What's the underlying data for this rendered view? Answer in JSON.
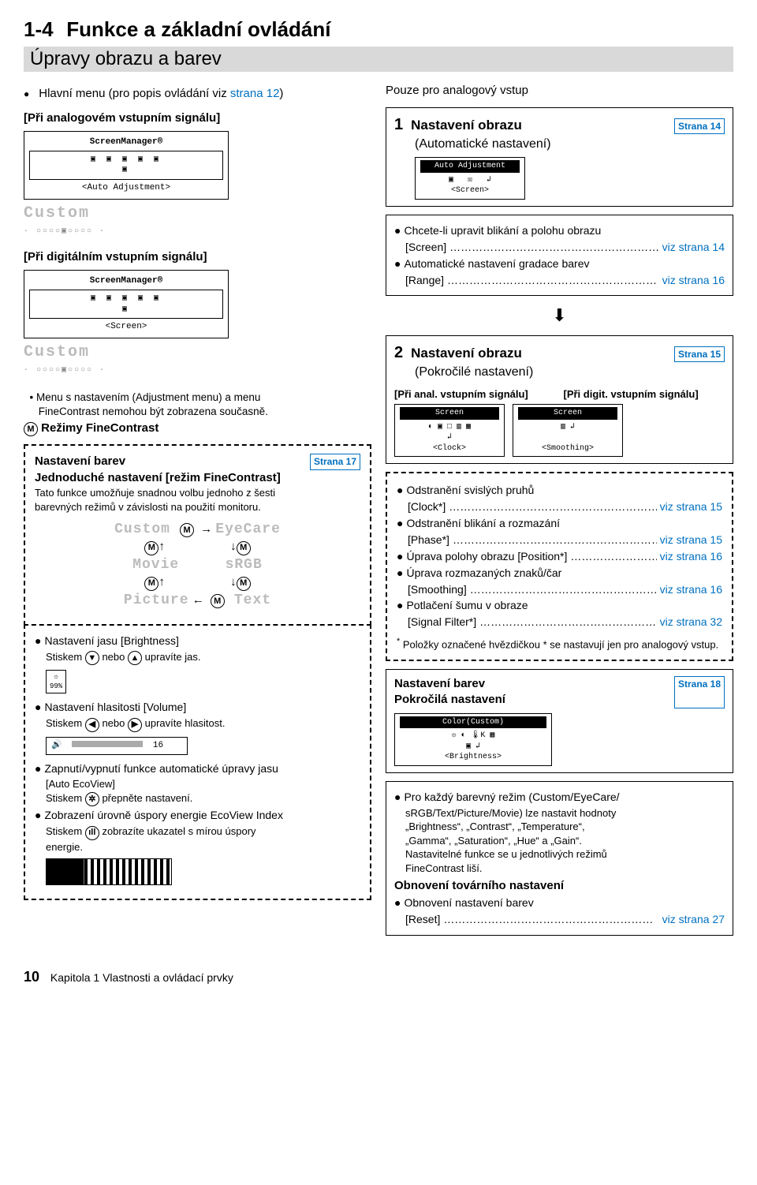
{
  "header": {
    "section": "1-4",
    "title": "Funkce a základní ovládání",
    "subsection": "Úpravy obrazu a barev"
  },
  "left": {
    "mainMenuLine_pre": "Hlavní menu (pro popis ovládání viz ",
    "mainMenuLine_link": "strana 12",
    "mainMenuLine_post": ")",
    "analogSignal": "[Při analogovém vstupním signálu]",
    "sm1_title": "ScreenManager®",
    "sm1_caption": "<Auto Adjustment>",
    "custom_ghost": "Custom",
    "digitalSignal": "[Při digitálním vstupním signálu]",
    "sm2_caption": "<Screen>",
    "menuNote1": "Menu s nastavením (Adjustment menu) a menu",
    "menuNote2": "FineContrast nemohou být zobrazena současně.",
    "mLabel": "Režimy FineContrast",
    "colorTitle": "Nastavení barev",
    "colorBadge": "Strana 17",
    "simpleMode": "Jednoduché nastavení [režim FineContrast]",
    "simpleDesc1": "Tato funkce umožňuje snadnou volbu jednoho z šesti",
    "simpleDesc2": "barevných režimů v závislosti na použití monitoru.",
    "modes": {
      "custom": "Custom",
      "eyecare": "EyeCare",
      "movie": "Movie",
      "srgb": "sRGB",
      "picture": "Picture",
      "text": "Text"
    },
    "brightTitle": "Nastavení jasu [Brightness]",
    "brightLine_a": "Stiskem ",
    "brightLine_b": " nebo ",
    "brightLine_c": " upravíte jas.",
    "smallOsd_val": "99%",
    "volTitle": "Nastavení hlasitosti [Volume]",
    "volLine_a": "Stiskem ",
    "volLine_b": " nebo ",
    "volLine_c": " upravíte hlasitost.",
    "vol_val": "16",
    "ecoTitle1": "Zapnutí/vypnutí funkce automatické úpravy jasu",
    "ecoTitle1b": "[Auto EcoView]",
    "ecoLine_a": "Stiskem ",
    "ecoLine_b": " přepněte nastavení.",
    "ecoTitle2": "Zobrazení úrovně úspory energie EcoView Index",
    "ecoLine2_a": "Stiskem ",
    "ecoLine2_b": " zobrazíte ukazatel s mírou úspory",
    "ecoLine2_c": "energie."
  },
  "right": {
    "analogOnly": "Pouze pro analogový vstup",
    "step1": {
      "num": "1",
      "title": "Nastavení obrazu",
      "sub": "(Automatické nastavení)",
      "badge": "Strana 14"
    },
    "osd1_black": "Auto Adjustment",
    "osd1_caption": "<Screen>",
    "box1": {
      "l1_lead": "Chcete-li upravit blikání a polohu obrazu",
      "l1_br": "[Screen]",
      "l1_link": "viz strana 14",
      "l2_lead": "Automatické nastavení gradace barev",
      "l2_br": "[Range]",
      "l2_link": "viz strana 16"
    },
    "step2": {
      "num": "2",
      "title": "Nastavení obrazu",
      "sub": "(Pokročilé nastavení)",
      "badge": "Strana 15"
    },
    "sigA": "[Při anal. vstupním signálu]",
    "sigD": "[Při digit. vstupním signálu]",
    "osd2_black": "Screen",
    "osd2a_cap": "<Clock>",
    "osd2b_cap": "<Smoothing>",
    "box2": {
      "i1_a": "Odstranění svislých pruhů",
      "i1_b": "[Clock*]",
      "i1_link": "viz strana 15",
      "i2_a": "Odstranění blikání a rozmazání",
      "i2_b": "[Phase*]",
      "i2_link": "viz strana 15",
      "i3_a": "Úprava polohy obrazu [Position*]",
      "i3_link": "viz strana 16",
      "i4_a": "Úprava rozmazaných znaků/čar",
      "i4_b": "[Smoothing]",
      "i4_link": "viz strana 16",
      "i5_a": "Potlačení šumu v obraze",
      "i5_b": "[Signal Filter*]",
      "i5_link": "viz strana 32",
      "note": "Položky označené hvězdičkou * se nastavují jen pro analogový vstup."
    },
    "colorAdv": {
      "t1": "Nastavení barev",
      "t2": "Pokročilá nastavení",
      "badge": "Strana 18"
    },
    "osd3_black": "Color(Custom)",
    "osd3_cap": "<Brightness>",
    "box3": {
      "l1": "Pro každý barevný režim (Custom/EyeCare/",
      "l2": "sRGB/Text/Picture/Movie) lze nastavit hodnoty",
      "l3": "„Brightness“, „Contrast“, „Temperature“,",
      "l4": "„Gamma“, „Saturation“, „Hue“ a „Gain“.",
      "l5": "Nastavitelné funkce se u jednotlivých režimů",
      "l6": "FineContrast liší.",
      "h": "Obnovení továrního nastavení",
      "r_a": "Obnovení nastavení barev",
      "r_b": "[Reset]",
      "r_link": "viz strana 27"
    }
  },
  "footer": {
    "pageNum": "10",
    "chapter": "Kapitola 1  Vlastnosti a ovládací prvky"
  }
}
